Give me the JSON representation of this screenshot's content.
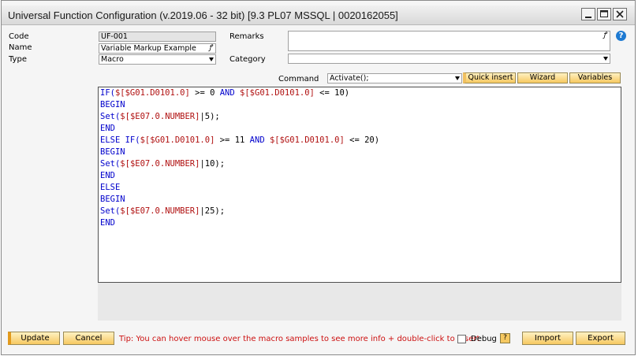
{
  "window": {
    "title": "Universal Function Configuration (v.2019.06 - 32 bit) [9.3 PL07 MSSQL | 0020162055]"
  },
  "form": {
    "code_label": "Code",
    "code_value": "UF-001",
    "name_label": "Name",
    "name_value": "Variable Markup Example",
    "type_label": "Type",
    "type_value": "Macro",
    "remarks_label": "Remarks",
    "remarks_value": "",
    "category_label": "Category",
    "category_value": "",
    "link_glyph": "ꝭ",
    "help_glyph": "?"
  },
  "command": {
    "label": "Command",
    "value": "Activate();",
    "quick_insert": "Quick insert",
    "wizard": "Wizard",
    "variables": "Variables"
  },
  "code_lines": [
    [
      {
        "t": "IF(",
        "c": "kw"
      },
      {
        "t": "$[$G01.D0101.0]",
        "c": "pm"
      },
      {
        "t": " >= 0 ",
        "c": "tx"
      },
      {
        "t": "AND ",
        "c": "kw"
      },
      {
        "t": "$[$G01.D0101.0]",
        "c": "pm"
      },
      {
        "t": " <= 10)",
        "c": "tx"
      }
    ],
    [
      {
        "t": "BEGIN",
        "c": "kw"
      }
    ],
    [
      {
        "t": "Set(",
        "c": "kw"
      },
      {
        "t": "$[$E07.0.NUMBER]",
        "c": "pm"
      },
      {
        "t": "|5);",
        "c": "tx"
      }
    ],
    [
      {
        "t": "END",
        "c": "kw"
      }
    ],
    [
      {
        "t": "ELSE IF(",
        "c": "kw"
      },
      {
        "t": "$[$G01.D0101.0]",
        "c": "pm"
      },
      {
        "t": " >= 11 ",
        "c": "tx"
      },
      {
        "t": "AND ",
        "c": "kw"
      },
      {
        "t": "$[$G01.D0101.0]",
        "c": "pm"
      },
      {
        "t": " <= 20)",
        "c": "tx"
      }
    ],
    [
      {
        "t": "BEGIN",
        "c": "kw"
      }
    ],
    [
      {
        "t": "Set(",
        "c": "kw"
      },
      {
        "t": "$[$E07.0.NUMBER]",
        "c": "pm"
      },
      {
        "t": "|10);",
        "c": "tx"
      }
    ],
    [
      {
        "t": "END",
        "c": "kw"
      }
    ],
    [
      {
        "t": "ELSE",
        "c": "kw"
      }
    ],
    [
      {
        "t": "BEGIN",
        "c": "kw"
      }
    ],
    [
      {
        "t": "Set(",
        "c": "kw"
      },
      {
        "t": "$[$E07.0.NUMBER]",
        "c": "pm"
      },
      {
        "t": "|25);",
        "c": "tx"
      }
    ],
    [
      {
        "t": "END",
        "c": "kw"
      }
    ]
  ],
  "footer": {
    "update": "Update",
    "cancel": "Cancel",
    "tip": "Tip: You can hover mouse over the macro samples to see more info + double-click to insert",
    "debug_label": "Debug",
    "debug_checked": false,
    "debug_help": "?",
    "import": "Import",
    "export": "Export"
  },
  "colors": {
    "keyword": "#0000cc",
    "placeholder": "#b01010",
    "tip": "#cc1010",
    "button": "#f6c860",
    "button_accent": "#e39a1c",
    "help": "#1e7ad2"
  },
  "icons": {
    "minimize": "minimize-icon",
    "maximize": "maximize-icon",
    "close": "close-icon",
    "help": "help-circle-icon",
    "link": "link-icon",
    "dropdown": "chevron-down-icon"
  }
}
